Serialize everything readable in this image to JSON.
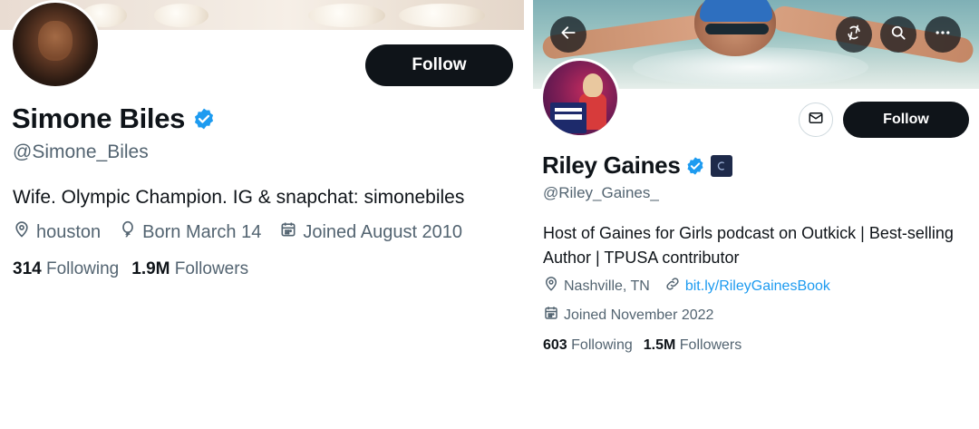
{
  "left_profile": {
    "name": "Simone Biles",
    "handle": "@Simone_Biles",
    "follow_label": "Follow",
    "bio": "Wife. Olympic Champion. IG & snapchat: simonebiles",
    "location": "houston",
    "birthday": "Born March 14",
    "joined": "Joined August 2010",
    "following_count": "314",
    "following_label": "Following",
    "followers_count": "1.9M",
    "followers_label": "Followers",
    "verified": true
  },
  "right_profile": {
    "name": "Riley Gaines",
    "handle": "@Riley_Gaines_",
    "follow_label": "Follow",
    "bio": "Host of Gaines for Girls podcast on Outkick | Best-selling Author | TPUSA contributor",
    "location": "Nashville, TN",
    "website": "bit.ly/RileyGainesBook",
    "joined": "Joined November 2022",
    "following_count": "603",
    "following_label": "Following",
    "followers_count": "1.5M",
    "followers_label": "Followers",
    "verified": true,
    "header_buttons": [
      "back-arrow-icon",
      "refresh-icon",
      "search-icon",
      "more-icon"
    ]
  },
  "colors": {
    "text_primary": "#0f1419",
    "text_secondary": "#536471",
    "verified_blue": "#1d9bf0",
    "link_blue": "#1d9bf0",
    "button_dark": "#0f1419"
  }
}
